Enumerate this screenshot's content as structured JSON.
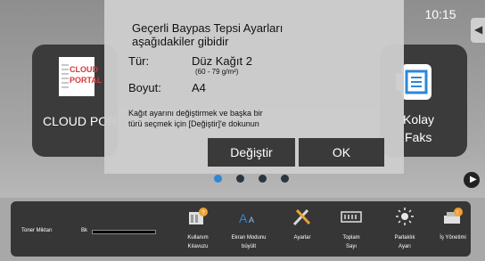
{
  "status": {
    "clock": "10:15"
  },
  "tiles": [
    {
      "label": "CLOUD POR",
      "icon": "cloud-portal-icon",
      "logo_line1": "CLOUD",
      "logo_line2": "PORTAL"
    },
    {
      "label_line1": "Kolay",
      "label_line2": "Faks",
      "icon": "fax-icon"
    }
  ],
  "pager": {
    "total": 4,
    "active": 0
  },
  "dialog": {
    "message_line1": "Geçerli Baypas Tepsi Ayarları",
    "message_line2": "aşağıdakiler gibidir",
    "type_label": "Tür:",
    "type_value": "Düz Kağıt 2",
    "weight": "(60 - 79 g/m²)",
    "size_label": "Boyut:",
    "size_value": "A4",
    "info_line1": "Kağıt ayarını değiştirmek ve başka bir",
    "info_line2": "türü seçmek için [Değiştir]'e dokunun",
    "change_button": "Değiştir",
    "ok_button": "OK"
  },
  "toner": {
    "label": "Toner Miktarı",
    "bk_label": "Bk"
  },
  "bottom_nav": [
    {
      "line1": "Kullanım",
      "line2": "Kılavuzu",
      "icon": "book-icon"
    },
    {
      "line1": "Ekran Modunu",
      "line2": "büyült",
      "icon": "text-size-icon"
    },
    {
      "line1": "Ayarlar",
      "line2": "",
      "icon": "tools-icon"
    },
    {
      "line1": "Toplam",
      "line2": "Sayı",
      "icon": "counter-icon"
    },
    {
      "line1": "Parlaklık",
      "line2": "Ayarı",
      "icon": "brightness-icon"
    },
    {
      "line1": "İş Yönetimi",
      "line2": "",
      "icon": "job-status-icon"
    }
  ],
  "colors": {
    "accent": "#2f86d6",
    "panel": "#363636",
    "dialog_bg": "#cdcdcd",
    "button": "#3a3a3a",
    "cloud_red": "#d43a3a",
    "icon_orange": "#f0a030"
  }
}
